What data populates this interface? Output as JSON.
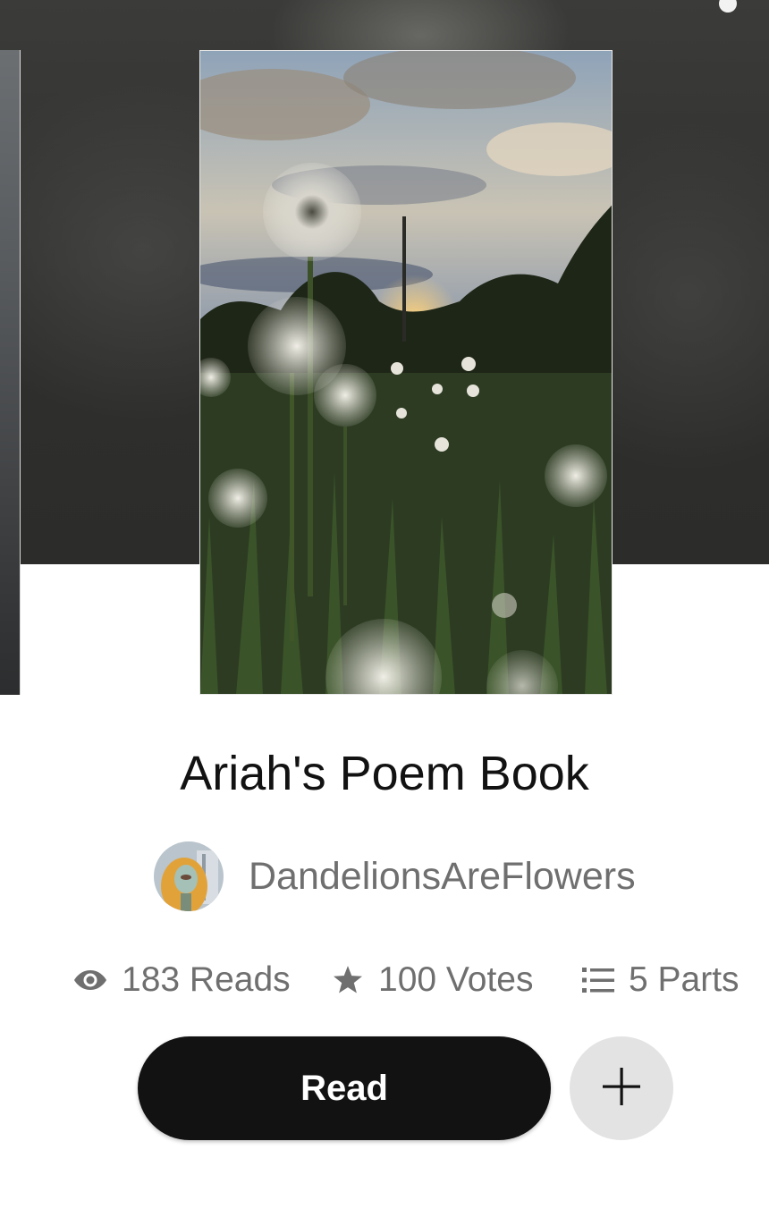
{
  "story": {
    "title": "Ariah's Poem Book",
    "author": "DandelionsAreFlowers"
  },
  "stats": {
    "reads": "183 Reads",
    "votes": "100 Votes",
    "parts": "5 Parts"
  },
  "actions": {
    "read_label": "Read"
  },
  "icons": {
    "reads": "eye-icon",
    "votes": "star-icon",
    "parts": "list-icon",
    "add": "plus-icon"
  },
  "colors": {
    "primary_button": "#121212",
    "secondary_button": "#e3e3e3",
    "title_text": "#121212",
    "meta_text": "#6f6f6f"
  }
}
